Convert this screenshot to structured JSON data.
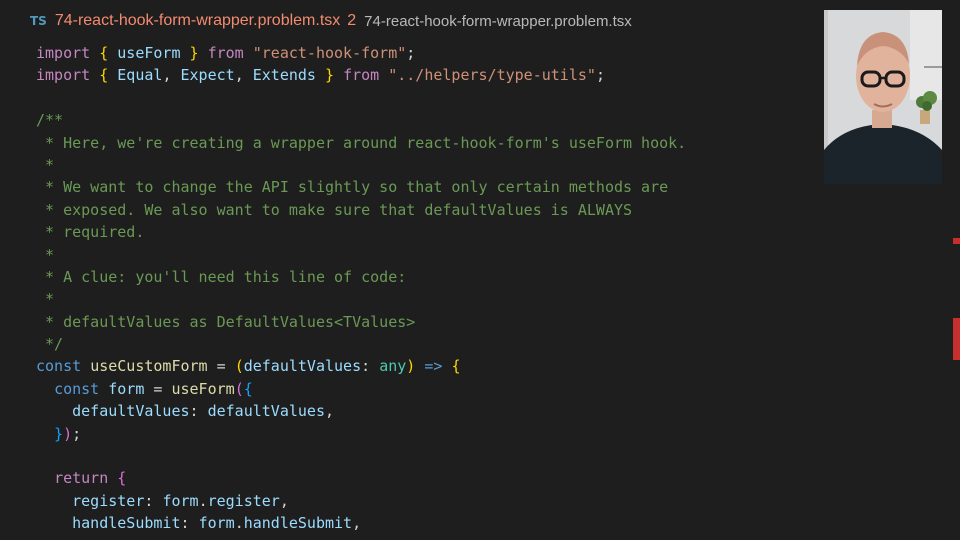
{
  "tab": {
    "lang_icon": "TS",
    "file_name": "74-react-hook-form-wrapper.problem.tsx",
    "problem_count": "2",
    "breadcrumb": "74-react-hook-form-wrapper.problem.tsx"
  },
  "code": {
    "l1": {
      "kw1": "import",
      "b1": "{",
      "name": "useForm",
      "b2": "}",
      "kw2": "from",
      "str": "\"react-hook-form\"",
      "semi": ";"
    },
    "l2": {
      "kw1": "import",
      "b1": "{",
      "n1": "Equal",
      "c1": ",",
      "n2": "Expect",
      "c2": ",",
      "n3": "Extends",
      "b2": "}",
      "kw2": "from",
      "str": "\"../helpers/type-utils\"",
      "semi": ";"
    },
    "comment": [
      "/**",
      " * Here, we're creating a wrapper around react-hook-form's useForm hook.",
      " *",
      " * We want to change the API slightly so that only certain methods are",
      " * exposed. We also want to make sure that defaultValues is ALWAYS",
      " * required.",
      " *",
      " * A clue: you'll need this line of code:",
      " *",
      " * defaultValues as DefaultValues<TValues>",
      " */"
    ],
    "l15": {
      "kw": "const",
      "name": "useCustomForm",
      "eq": "=",
      "p1": "(",
      "param": "defaultValues",
      "colon": ":",
      "type": "any",
      "p2": ")",
      "arrow": "=>",
      "b": "{"
    },
    "l16": {
      "kw": "const",
      "name": "form",
      "eq": "=",
      "fn": "useForm",
      "p1": "(",
      "b": "{"
    },
    "l17": {
      "key": "defaultValues",
      "colon": ":",
      "val": "defaultValues",
      "comma": ","
    },
    "l18": {
      "b": "}",
      "p": ")",
      "semi": ";"
    },
    "l20": {
      "kw": "return",
      "b": "{"
    },
    "l21": {
      "key": "register",
      "colon": ":",
      "obj": "form",
      "dot": ".",
      "prop": "register",
      "comma": ","
    },
    "l22": {
      "key": "handleSubmit",
      "colon": ":",
      "obj": "form",
      "dot": ".",
      "prop": "handleSubmit",
      "comma": ","
    }
  }
}
